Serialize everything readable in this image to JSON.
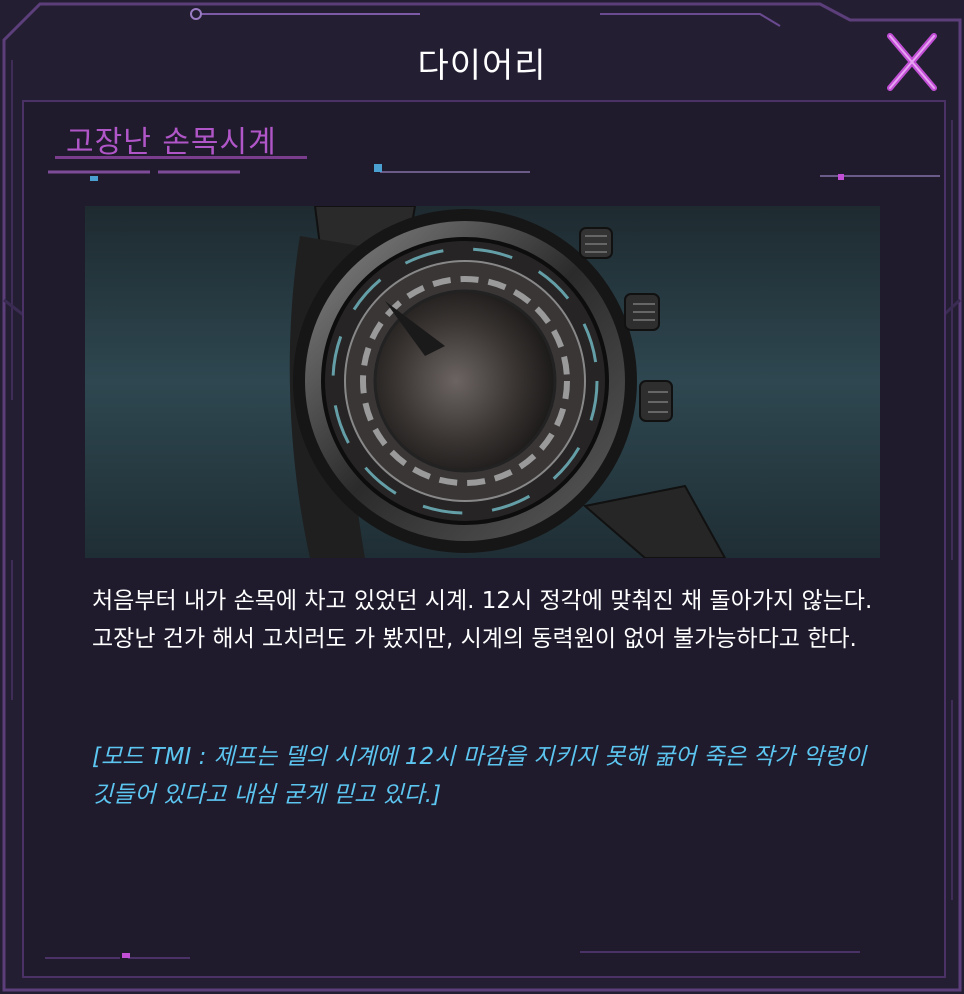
{
  "window": {
    "title": "다이어리",
    "close_icon": "close-x-icon",
    "accent_color": "#c24fd6",
    "text_color": "#ffffff",
    "tmi_color": "#5cc5f0"
  },
  "entry": {
    "item_name": "고장난 손목시계",
    "image": "broken-wristwatch-illustration",
    "description": "처음부터 내가 손목에 차고 있었던 시계. 12시 정각에 맞춰진 채 돌아가지 않는다. 고장난 건가 해서 고치러도 가 봤지만, 시계의 동력원이 없어 불가능하다고 한다.",
    "tmi": "[모드 TMI : 제프는 델의 시계에 12시 마감을 지키지 못해 굶어 죽은 작가 악령이 깃들어 있다고 내심 굳게 믿고 있다.]"
  }
}
